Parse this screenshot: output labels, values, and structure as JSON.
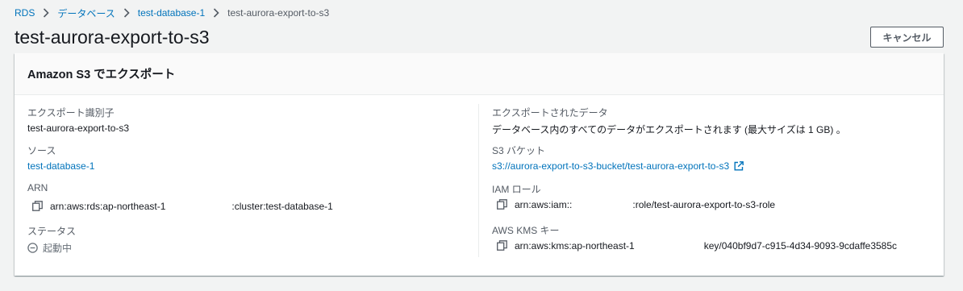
{
  "breadcrumb": {
    "items": [
      "RDS",
      "データベース",
      "test-database-1"
    ],
    "current": "test-aurora-export-to-s3"
  },
  "page_title": "test-aurora-export-to-s3",
  "cancel_label": "キャンセル",
  "panel": {
    "title": "Amazon S3 でエクスポート",
    "left": {
      "export_id_label": "エクスポート識別子",
      "export_id_value": "test-aurora-export-to-s3",
      "source_label": "ソース",
      "source_value": "test-database-1",
      "arn_label": "ARN",
      "arn_prefix": "arn:aws:rds:ap-northeast-1",
      "arn_suffix": ":cluster:test-database-1",
      "status_label": "ステータス",
      "status_value": "起動中"
    },
    "right": {
      "exported_data_label": "エクスポートされたデータ",
      "exported_data_value": "データベース内のすべてのデータがエクスポートされます (最大サイズは 1 GB) 。",
      "bucket_label": "S3 バケット",
      "bucket_value": "s3://aurora-export-to-s3-bucket/test-aurora-export-to-s3",
      "iam_label": "IAM ロール",
      "iam_prefix": "arn:aws:iam::",
      "iam_suffix": ":role/test-aurora-export-to-s3-role",
      "kms_label": "AWS KMS キー",
      "kms_prefix": "arn:aws:kms:ap-northeast-1",
      "kms_suffix": "key/040bf9d7-c915-4d34-9093-9cdaffe3585c"
    }
  }
}
